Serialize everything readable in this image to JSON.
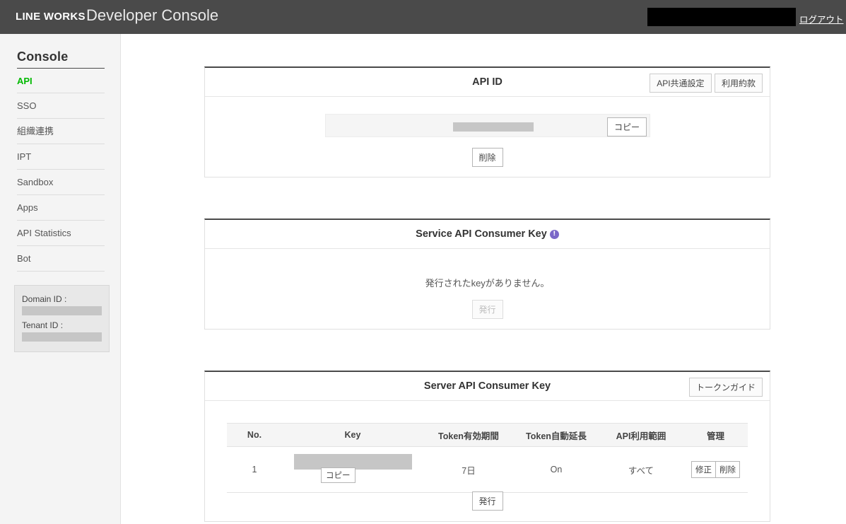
{
  "header": {
    "logo_text": "LINE WORKS",
    "product_name": "Developer Console",
    "account_masked": "",
    "logout_label": "ログアウト"
  },
  "sidebar": {
    "title": "Console",
    "items": [
      {
        "label": "API",
        "active": true
      },
      {
        "label": "SSO",
        "active": false
      },
      {
        "label": "組織連携",
        "active": false
      },
      {
        "label": "IPT",
        "active": false
      },
      {
        "label": "Sandbox",
        "active": false
      },
      {
        "label": "Apps",
        "active": false
      },
      {
        "label": "API Statistics",
        "active": false
      },
      {
        "label": "Bot",
        "active": false
      }
    ],
    "info_box": {
      "domain_id_label": "Domain ID :",
      "domain_id_value": "",
      "tenant_id_label": "Tenant ID :",
      "tenant_id_value": ""
    }
  },
  "panels": {
    "api_id": {
      "title": "API ID",
      "common_settings_label": "API共通設定",
      "terms_label": "利用約款",
      "value_masked": "",
      "copy_label": "コピー",
      "delete_label": "削除"
    },
    "service_api_consumer_key": {
      "title": "Service API Consumer Key",
      "info_icon_glyph": "!",
      "empty_message": "発行されたkeyがありません。",
      "issue_label": "発行",
      "issue_disabled": true
    },
    "server_api_consumer_key": {
      "title": "Server API Consumer Key",
      "token_guide_label": "トークンガイド",
      "columns": [
        "No.",
        "Key",
        "Token有効期間",
        "Token自動延長",
        "API利用範囲",
        "管理"
      ],
      "rows": [
        {
          "no": "1",
          "key_masked": "",
          "copy_label": "コピー",
          "token_expiry": "7日",
          "token_auto_extend": "On",
          "api_scope": "すべて",
          "edit_label": "修正",
          "delete_label": "削除"
        }
      ],
      "issue_label": "発行"
    }
  },
  "colors": {
    "header_bg": "#4a4a4a",
    "sidebar_bg": "#f4f4f4",
    "active_nav": "#00b900",
    "info_icon": "#7b68c8",
    "mask": "#c6c6c6"
  }
}
